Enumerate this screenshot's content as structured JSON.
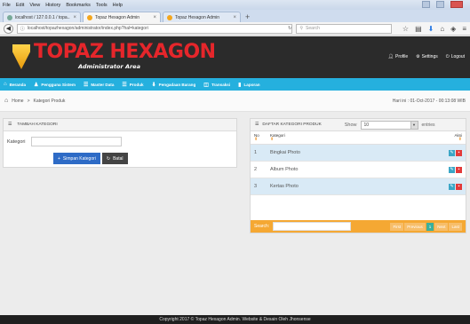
{
  "browser": {
    "menus": [
      "File",
      "Edit",
      "View",
      "History",
      "Bookmarks",
      "Tools",
      "Help"
    ],
    "tabs": [
      {
        "label": "localhost / 127.0.0.1 / topa..."
      },
      {
        "label": "Topaz Hexagon Admin"
      },
      {
        "label": "Topaz Hexagon Admin"
      }
    ],
    "new_tab": "+",
    "url": "localhost/topazhexagon/administrator/index.php?hal=kategori",
    "search_placeholder": "Search"
  },
  "header": {
    "logo_title": "TOPAZ HEXAGON",
    "logo_subtitle": "Administrator Area",
    "links": [
      {
        "icon": "user-icon",
        "label": "Profile"
      },
      {
        "icon": "gear-icon",
        "label": "Settings"
      },
      {
        "icon": "power-icon",
        "label": "Logout"
      }
    ]
  },
  "nav": [
    {
      "icon": "home-icon",
      "label": "Beranda"
    },
    {
      "icon": "user-icon",
      "label": "Pengguna Sistem"
    },
    {
      "icon": "list-icon",
      "label": "Master Data"
    },
    {
      "icon": "list-icon",
      "label": "Produk"
    },
    {
      "icon": "download-icon",
      "label": "Pengadaan Barang"
    },
    {
      "icon": "cart-icon",
      "label": "Transaksi"
    },
    {
      "icon": "report-icon",
      "label": "Laporan"
    }
  ],
  "breadcrumb": {
    "home": "Home",
    "sep": ">",
    "current": "Kategori Produk",
    "date": "Hari ini : 01-Oct-2017 - 00:13:08 WIB"
  },
  "form_panel": {
    "title": "TAMBAH KATEGORI",
    "field_label": "Kategori",
    "field_value": "",
    "save_label": "Simpan Kategori",
    "cancel_label": "Batal"
  },
  "table_panel": {
    "title": "DAFTAR KATEGORI PRODUK",
    "show_label": "Show",
    "show_value": "10",
    "entries_label": "entries",
    "columns": {
      "no": "No",
      "kategori": "Kategori",
      "aksi": "Aksi"
    },
    "rows": [
      {
        "no": "1",
        "kategori": "Bingkai Photo"
      },
      {
        "no": "2",
        "kategori": "Album Photo"
      },
      {
        "no": "3",
        "kategori": "Kertas Photo"
      }
    ],
    "search_label": "Search:",
    "pagination": [
      "First",
      "Previous",
      "1",
      "Next",
      "Last"
    ]
  },
  "footer": {
    "text": "Copyright 2017 © Topaz Hexagon Admin. Website & Desain Oleh Jhonsense"
  },
  "colors": {
    "header_bg": "#2b2b2b",
    "logo_red": "#e5262b",
    "nav_blue": "#25b0de",
    "row_highlight": "#d9eaf6",
    "table_footer": "#f5a833",
    "primary_button": "#2e6bc6",
    "delete_button": "#e33a3a"
  }
}
